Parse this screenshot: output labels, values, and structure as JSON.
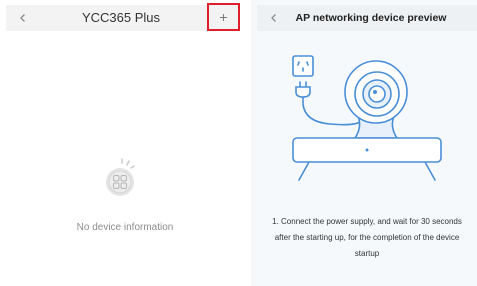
{
  "left_screen": {
    "navbar": {
      "title": "YCC365 Plus",
      "add_label": "+"
    },
    "empty_state": {
      "icon": "empty-devices-icon",
      "message": "No device information"
    },
    "highlight_color": "#e01e2b"
  },
  "right_screen": {
    "navbar": {
      "title": "AP networking device preview"
    },
    "illustration": "camera-power-plug-illustration",
    "instruction": "1. Connect the power supply, and wait for 30 seconds after the starting up, for the completion of the device startup",
    "accent_color": "#4a8fd6"
  }
}
